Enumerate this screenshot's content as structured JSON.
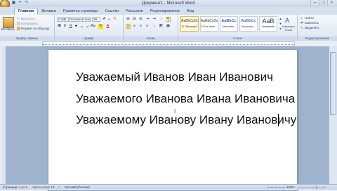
{
  "window": {
    "title": "Документ1 - Microsoft Word",
    "buttons": [
      "–",
      "□",
      "×"
    ]
  },
  "qat": [
    "save-icon",
    "undo-icon",
    "redo-icon"
  ],
  "tabs": [
    "Главная",
    "Вставка",
    "Разметка страницы",
    "Ссылки",
    "Рассылки",
    "Рецензирование",
    "Вид"
  ],
  "ribbon": {
    "clipboard": {
      "paste": "Вставить",
      "cut": "Вырезать",
      "copy": "Копировать",
      "format_painter": "Формат по образцу",
      "label": "Буфер обмена"
    },
    "font": {
      "name": "Calibri (Основной текст)",
      "size": "28",
      "label": "Шрифт"
    },
    "paragraph": {
      "label": "Абзац"
    },
    "styles": {
      "items": [
        {
          "preview": "AaBbCcDc",
          "name": "¶ Обычный"
        },
        {
          "preview": "AaBbCcDc",
          "name": "¶ Без инте..."
        },
        {
          "preview": "AaBbCc",
          "name": "Заголово..."
        },
        {
          "preview": "AaBbCc",
          "name": "Заголово..."
        },
        {
          "preview": "AaB",
          "name": "Название"
        }
      ],
      "change": "Изменить стили",
      "label": "Стили"
    },
    "editing": {
      "find": "Найти",
      "replace": "Заменить",
      "select": "Выделить",
      "label": "Редактирование"
    }
  },
  "document": {
    "lines": [
      "Уважаемый Иванов Иван Иванович",
      "Уважаемого Иванова Ивана Ивановича",
      "Уважаемому Иванову Ивану Ивановичу"
    ]
  },
  "status": {
    "page": "Страница: 1 из 1",
    "words": "Число слов: 12",
    "language": "Русский (Россия)",
    "zoom": "120%"
  }
}
